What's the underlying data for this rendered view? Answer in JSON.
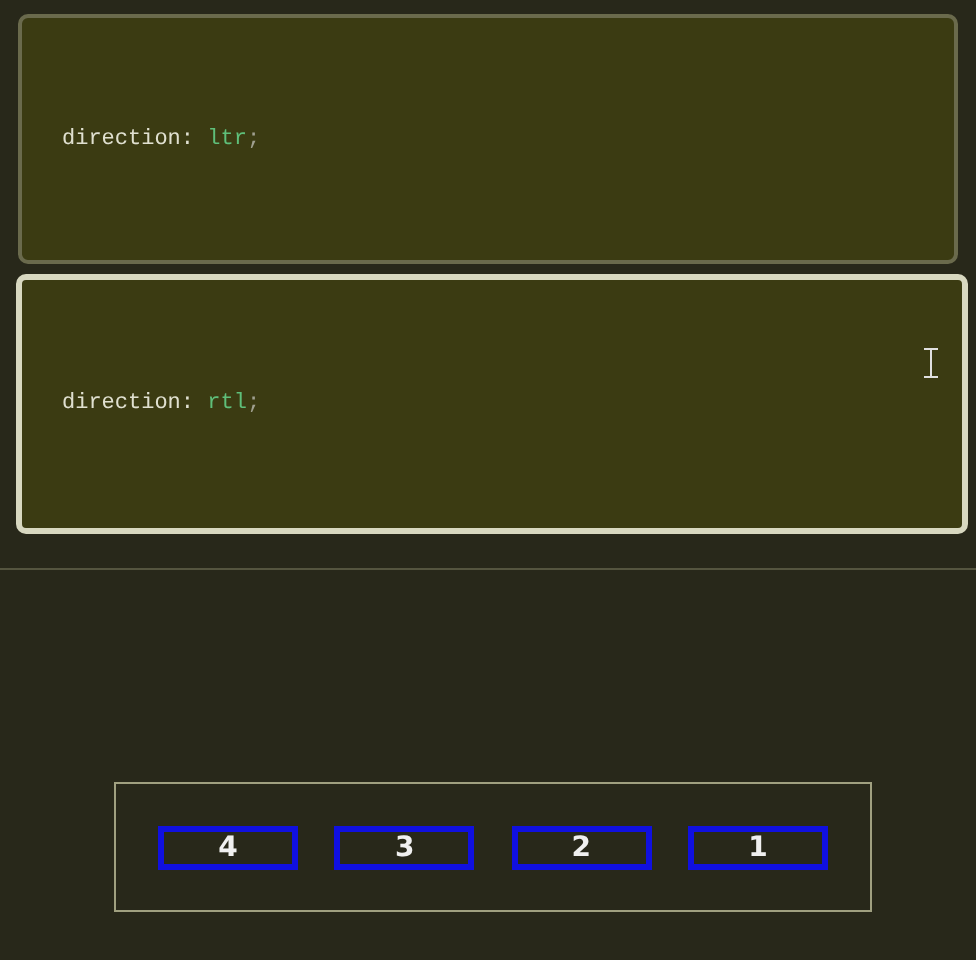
{
  "editors": [
    {
      "property": "direction: ",
      "value": "ltr",
      "terminator": ";",
      "selected": false,
      "cursor": false
    },
    {
      "property": "direction: ",
      "value": "rtl",
      "terminator": ";",
      "selected": true,
      "cursor": true
    }
  ],
  "demo": {
    "items": [
      "4",
      "3",
      "2",
      "1"
    ]
  }
}
